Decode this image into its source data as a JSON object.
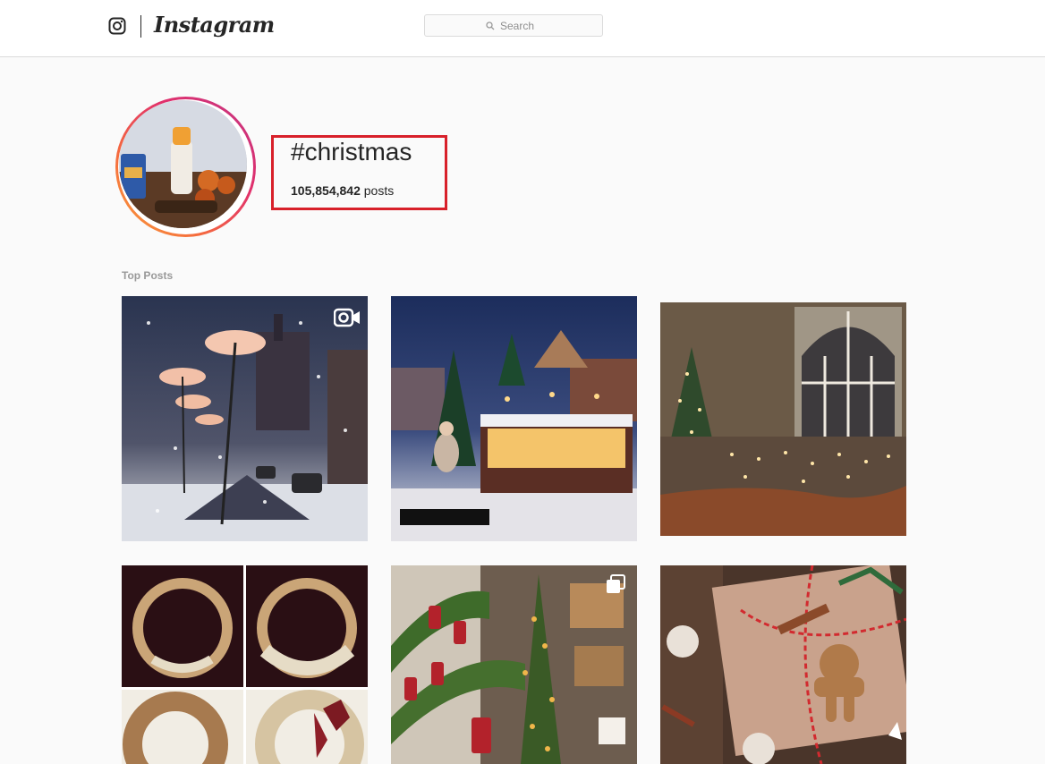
{
  "nav": {
    "wordmark": "Instagram",
    "search_placeholder": "Search"
  },
  "header": {
    "hashtag": "#christmas",
    "post_count": "105,854,842",
    "post_count_suffix": " posts"
  },
  "sections": {
    "top_posts_label": "Top Posts"
  },
  "posts": [
    {
      "subject": "snowy street with umbrella lights",
      "media_type": "video"
    },
    {
      "subject": "christmas market at night",
      "media_type": "image"
    },
    {
      "subject": "christmas tree and village display",
      "media_type": "image"
    },
    {
      "subject": "wine cork wreath collage",
      "media_type": "image"
    },
    {
      "subject": "decorated christmas tree with stockings",
      "media_type": "carousel"
    },
    {
      "subject": "gift wrapped with gingerbread and cinnamon",
      "media_type": "image"
    }
  ],
  "colors": {
    "highlight_box": "#d8202a",
    "ring_start": "#f9a33b",
    "ring_end": "#c13584",
    "background": "#fafafa"
  }
}
